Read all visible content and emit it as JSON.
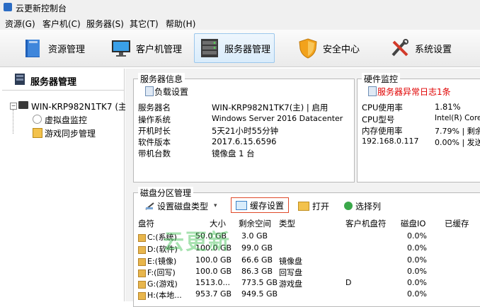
{
  "window": {
    "title": "云更新控制台"
  },
  "menu": [
    {
      "label": "资源(G)"
    },
    {
      "label": "客户机(C)"
    },
    {
      "label": "服务器(S)"
    },
    {
      "label": "其它(T)"
    },
    {
      "label": "帮助(H)"
    }
  ],
  "toolbar": [
    {
      "label": "资源管理",
      "icon": "book-icon"
    },
    {
      "label": "客户机管理",
      "icon": "monitor-icon"
    },
    {
      "label": "服务器管理",
      "icon": "server-icon"
    },
    {
      "label": "安全中心",
      "icon": "shield-icon"
    },
    {
      "label": "系统设置",
      "icon": "tools-icon"
    }
  ],
  "sidebar": {
    "header": "服务器管理",
    "tree": [
      {
        "label": "WIN-KRP982N1TK7 (主)"
      },
      {
        "label": "虚拟盘监控"
      },
      {
        "label": "游戏同步管理"
      }
    ]
  },
  "server_info": {
    "title": "服务器信息",
    "load_settings": "负载设置",
    "rows": [
      {
        "key": "服务器名",
        "value": "WIN-KRP982N1TK7(主) | 启用"
      },
      {
        "key": "操作系统",
        "value": "Windows Server 2016 Datacenter"
      },
      {
        "key": "开机时长",
        "value": "5天21小时55分钟"
      },
      {
        "key": "软件版本",
        "value": "2017.6.15.6596"
      },
      {
        "key": "带机台数",
        "value": "镜像盘 1 台"
      }
    ]
  },
  "hardware": {
    "title": "硬件监控",
    "alert": "服务器异常日志1条",
    "rows": [
      {
        "key": "CPU使用率",
        "value": "1.81%"
      },
      {
        "key": "CPU型号",
        "value": "Intel(R) Core"
      },
      {
        "key": "内存使用率",
        "value": "7.79% | 剩余"
      },
      {
        "key": "192.168.0.117",
        "value": "0.00% | 发送"
      }
    ]
  },
  "disk": {
    "title": "磁盘分区管理",
    "toolbar": {
      "set_type": "设置磁盘类型",
      "cache": "缓存设置",
      "open": "打开",
      "columns": "选择列"
    },
    "columns": [
      "盘符",
      "大小",
      "剩余空间",
      "类型",
      "客户机盘符",
      "磁盘IO",
      "已缓存"
    ],
    "rows": [
      {
        "drive": "C:(系统)",
        "size": "50.0 GB",
        "free": "3.0 GB",
        "type": "",
        "client": "",
        "io": "0.0%"
      },
      {
        "drive": "D:(软件)",
        "size": "100.0 GB",
        "free": "99.0 GB",
        "type": "",
        "client": "",
        "io": "0.0%"
      },
      {
        "drive": "E:(镜像)",
        "size": "100.0 GB",
        "free": "66.6 GB",
        "type": "镜像盘",
        "client": "",
        "io": "0.0%"
      },
      {
        "drive": "F:(回写)",
        "size": "100.0 GB",
        "free": "86.3 GB",
        "type": "回写盘",
        "client": "",
        "io": "0.0%"
      },
      {
        "drive": "G:(游戏)",
        "size": "1513.0...",
        "free": "773.5 GB",
        "type": "游戏盘",
        "client": "D",
        "io": "0.0%"
      },
      {
        "drive": "H:(本地...",
        "size": "953.7 GB",
        "free": "949.5 GB",
        "type": "",
        "client": "",
        "io": "0.0%"
      }
    ]
  },
  "watermark": "云更新",
  "colors": {
    "accent": "#2b6cc4",
    "alert": "#e00000",
    "active_tab_border": "#9cc7ec"
  }
}
